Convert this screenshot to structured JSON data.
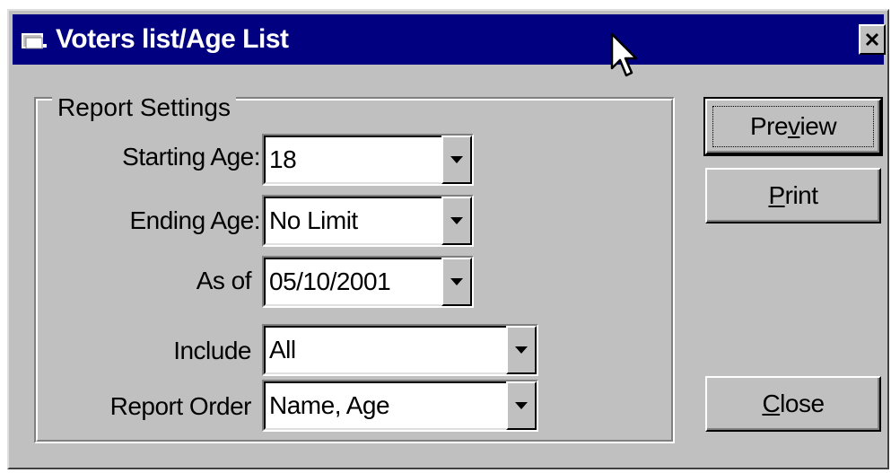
{
  "window": {
    "title": "Voters list/Age List",
    "close_glyph": "✕"
  },
  "group": {
    "legend": "Report Settings"
  },
  "fields": {
    "starting_age": {
      "label": "Starting Age:",
      "value": "18"
    },
    "ending_age": {
      "label": "Ending Age:",
      "value": "No Limit"
    },
    "as_of": {
      "label": "As of",
      "value": "05/10/2001"
    },
    "include": {
      "label": "Include",
      "value": "All"
    },
    "report_order": {
      "label": "Report Order",
      "value": "Name, Age"
    }
  },
  "buttons": {
    "preview": {
      "pre": "Pre",
      "mnemonic": "v",
      "post": "iew"
    },
    "print": {
      "pre": "",
      "mnemonic": "P",
      "post": "rint"
    },
    "close": {
      "pre": "",
      "mnemonic": "C",
      "post": "lose"
    }
  },
  "icons": {
    "title_icon": "app-folder-icon",
    "dropdown": "dropdown-arrow-icon",
    "cursor": "mouse-pointer-icon"
  },
  "colors": {
    "titlebar": "#000080",
    "face": "#c0c0c0",
    "field": "#ffffff"
  }
}
